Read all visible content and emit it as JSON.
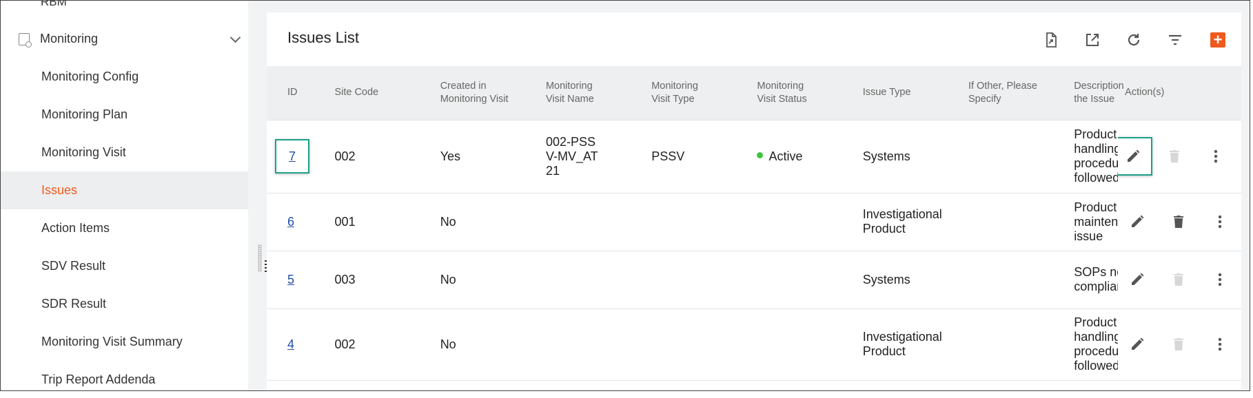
{
  "sidebar": {
    "top_partial_label": "RBM",
    "group_label": "Monitoring",
    "items": [
      {
        "label": "Monitoring Config"
      },
      {
        "label": "Monitoring Plan"
      },
      {
        "label": "Monitoring Visit"
      },
      {
        "label": "Issues"
      },
      {
        "label": "Action Items"
      },
      {
        "label": "SDV Result"
      },
      {
        "label": "SDR Result"
      },
      {
        "label": "Monitoring Visit Summary"
      },
      {
        "label": "Trip Report Addenda"
      }
    ],
    "active_item": "Issues"
  },
  "page": {
    "title": "Issues List",
    "toolbar": [
      "export-document-icon",
      "open-external-icon",
      "refresh-icon",
      "filter-icon",
      "add-icon"
    ],
    "accent_color": "#f05a1e",
    "highlight_color": "#1aa088"
  },
  "table": {
    "columns": [
      {
        "label": "ID"
      },
      {
        "label": "Site Code"
      },
      {
        "label": "Created in Monitoring Visit"
      },
      {
        "label": "Monitoring Visit Name"
      },
      {
        "label": "Monitoring Visit Type"
      },
      {
        "label": "Monitoring Visit Status"
      },
      {
        "label": "Issue Type"
      },
      {
        "label": "If Other, Please Specify"
      },
      {
        "label": "Description the Issue"
      },
      {
        "label": "Action(s)"
      }
    ],
    "rows": [
      {
        "id": "7",
        "site_code": "002",
        "created_in_visit": "Yes",
        "visit_name": "002-PSSV-MV_AT21",
        "visit_type": "PSSV",
        "visit_status": "Active",
        "issue_type": "Systems",
        "other": "",
        "description": [
          "Product",
          "handling",
          "procedure",
          "followed"
        ],
        "delete_enabled": false
      },
      {
        "id": "6",
        "site_code": "001",
        "created_in_visit": "No",
        "visit_name": "",
        "visit_type": "",
        "visit_status": "",
        "issue_type": "Investigational Product",
        "other": "",
        "description": [
          "Product",
          "maintenar",
          "issue"
        ],
        "delete_enabled": true
      },
      {
        "id": "5",
        "site_code": "003",
        "created_in_visit": "No",
        "visit_name": "",
        "visit_type": "",
        "visit_status": "",
        "issue_type": "Systems",
        "other": "",
        "description": [
          "SOPs not",
          "compliant"
        ],
        "delete_enabled": false
      },
      {
        "id": "4",
        "site_code": "002",
        "created_in_visit": "No",
        "visit_name": "",
        "visit_type": "",
        "visit_status": "",
        "issue_type": "Investigational Product",
        "other": "",
        "description": [
          "Product",
          "handling",
          "procedure",
          "followed"
        ],
        "delete_enabled": false
      }
    ]
  }
}
